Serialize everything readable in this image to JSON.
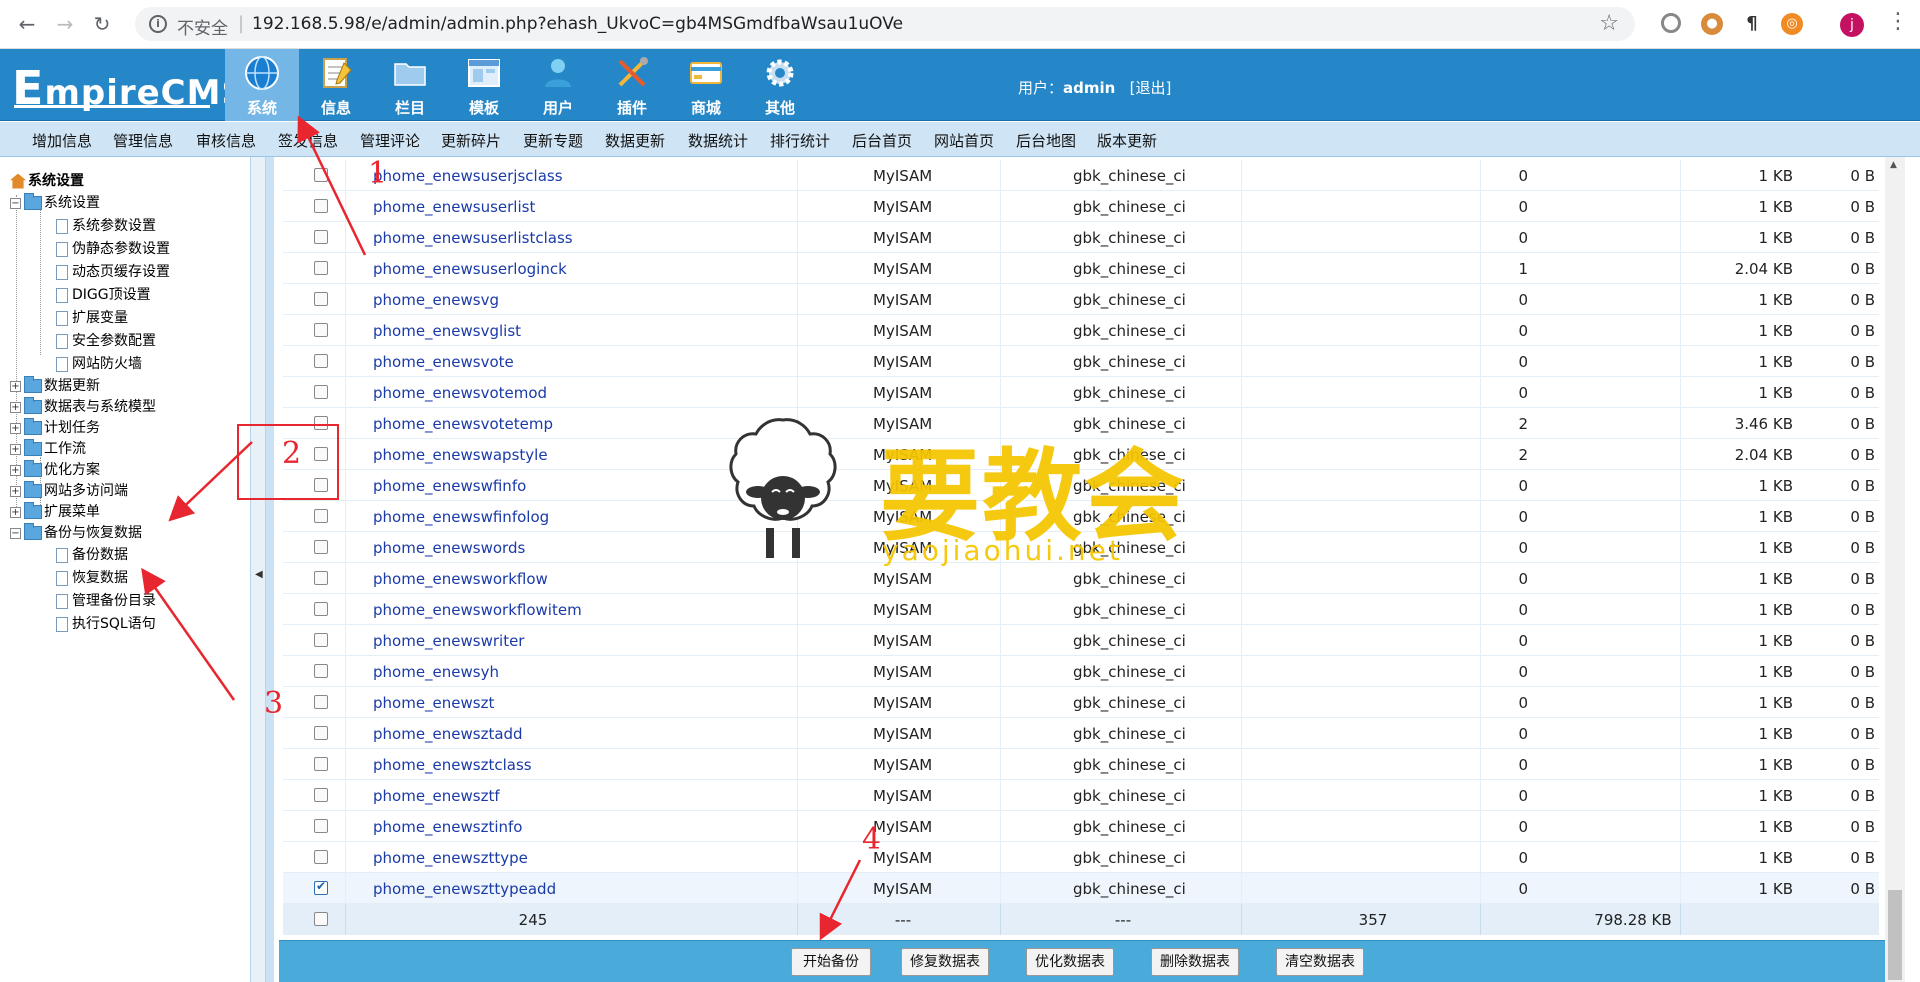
{
  "browser": {
    "security": "不安全",
    "url": "192.168.5.98/e/admin/admin.php?ehash_UkvoC=gb4MSGmdfbaWsau1uOVe",
    "profile_initial": "j"
  },
  "cms": {
    "logo": "EmpireCMS",
    "logo_rest": "mpireCMS",
    "logo_first": "E",
    "top_menu": [
      "系统",
      "信息",
      "栏目",
      "模板",
      "用户",
      "插件",
      "商城",
      "其他"
    ],
    "user_label": "用户：",
    "user_name": "admin",
    "logout": "[退出]",
    "sub_menu": [
      "增加信息",
      "管理信息",
      "审核信息",
      "签发信息",
      "管理评论",
      "更新碎片",
      "更新专题",
      "数据更新",
      "数据统计",
      "排行统计",
      "后台首页",
      "网站首页",
      "后台地图",
      "版本更新"
    ]
  },
  "tree": {
    "root": "系统设置",
    "system": "系统设置",
    "system_children": [
      "系统参数设置",
      "伪静态参数设置",
      "动态页缓存设置",
      "DIGG顶设置",
      "扩展变量",
      "安全参数配置",
      "网站防火墙"
    ],
    "folders": [
      "数据更新",
      "数据表与系统模型",
      "计划任务",
      "工作流",
      "优化方案",
      "网站多访问端",
      "扩展菜单"
    ],
    "backup": "备份与恢复数据",
    "backup_children": [
      "备份数据",
      "恢复数据",
      "管理备份目录",
      "执行SQL语句"
    ]
  },
  "table": {
    "rows": [
      {
        "name": "phome_enewsuserjsclass",
        "engine": "MyISAM",
        "collation": "gbk_chinese_ci",
        "rows": "0",
        "size": "1 KB",
        "free": "0 B",
        "checked": false
      },
      {
        "name": "phome_enewsuserlist",
        "engine": "MyISAM",
        "collation": "gbk_chinese_ci",
        "rows": "0",
        "size": "1 KB",
        "free": "0 B",
        "checked": false
      },
      {
        "name": "phome_enewsuserlistclass",
        "engine": "MyISAM",
        "collation": "gbk_chinese_ci",
        "rows": "0",
        "size": "1 KB",
        "free": "0 B",
        "checked": false
      },
      {
        "name": "phome_enewsuserloginck",
        "engine": "MyISAM",
        "collation": "gbk_chinese_ci",
        "rows": "1",
        "size": "2.04 KB",
        "free": "0 B",
        "checked": false
      },
      {
        "name": "phome_enewsvg",
        "engine": "MyISAM",
        "collation": "gbk_chinese_ci",
        "rows": "0",
        "size": "1 KB",
        "free": "0 B",
        "checked": false
      },
      {
        "name": "phome_enewsvglist",
        "engine": "MyISAM",
        "collation": "gbk_chinese_ci",
        "rows": "0",
        "size": "1 KB",
        "free": "0 B",
        "checked": false
      },
      {
        "name": "phome_enewsvote",
        "engine": "MyISAM",
        "collation": "gbk_chinese_ci",
        "rows": "0",
        "size": "1 KB",
        "free": "0 B",
        "checked": false
      },
      {
        "name": "phome_enewsvotemod",
        "engine": "MyISAM",
        "collation": "gbk_chinese_ci",
        "rows": "0",
        "size": "1 KB",
        "free": "0 B",
        "checked": false
      },
      {
        "name": "phome_enewsvotetemp",
        "engine": "MyISAM",
        "collation": "gbk_chinese_ci",
        "rows": "2",
        "size": "3.46 KB",
        "free": "0 B",
        "checked": false
      },
      {
        "name": "phome_enewswapstyle",
        "engine": "MyISAM",
        "collation": "gbk_chinese_ci",
        "rows": "2",
        "size": "2.04 KB",
        "free": "0 B",
        "checked": false
      },
      {
        "name": "phome_enewswfinfo",
        "engine": "MyISAM",
        "collation": "gbk_chinese_ci",
        "rows": "0",
        "size": "1 KB",
        "free": "0 B",
        "checked": false
      },
      {
        "name": "phome_enewswfinfolog",
        "engine": "MyISAM",
        "collation": "gbk_chinese_ci",
        "rows": "0",
        "size": "1 KB",
        "free": "0 B",
        "checked": false
      },
      {
        "name": "phome_enewswords",
        "engine": "MyISAM",
        "collation": "gbk_chinese_ci",
        "rows": "0",
        "size": "1 KB",
        "free": "0 B",
        "checked": false
      },
      {
        "name": "phome_enewsworkflow",
        "engine": "MyISAM",
        "collation": "gbk_chinese_ci",
        "rows": "0",
        "size": "1 KB",
        "free": "0 B",
        "checked": false
      },
      {
        "name": "phome_enewsworkflowitem",
        "engine": "MyISAM",
        "collation": "gbk_chinese_ci",
        "rows": "0",
        "size": "1 KB",
        "free": "0 B",
        "checked": false
      },
      {
        "name": "phome_enewswriter",
        "engine": "MyISAM",
        "collation": "gbk_chinese_ci",
        "rows": "0",
        "size": "1 KB",
        "free": "0 B",
        "checked": false
      },
      {
        "name": "phome_enewsyh",
        "engine": "MyISAM",
        "collation": "gbk_chinese_ci",
        "rows": "0",
        "size": "1 KB",
        "free": "0 B",
        "checked": false
      },
      {
        "name": "phome_enewszt",
        "engine": "MyISAM",
        "collation": "gbk_chinese_ci",
        "rows": "0",
        "size": "1 KB",
        "free": "0 B",
        "checked": false
      },
      {
        "name": "phome_enewsztadd",
        "engine": "MyISAM",
        "collation": "gbk_chinese_ci",
        "rows": "0",
        "size": "1 KB",
        "free": "0 B",
        "checked": false
      },
      {
        "name": "phome_enewsztclass",
        "engine": "MyISAM",
        "collation": "gbk_chinese_ci",
        "rows": "0",
        "size": "1 KB",
        "free": "0 B",
        "checked": false
      },
      {
        "name": "phome_enewsztf",
        "engine": "MyISAM",
        "collation": "gbk_chinese_ci",
        "rows": "0",
        "size": "1 KB",
        "free": "0 B",
        "checked": false
      },
      {
        "name": "phome_enewsztinfo",
        "engine": "MyISAM",
        "collation": "gbk_chinese_ci",
        "rows": "0",
        "size": "1 KB",
        "free": "0 B",
        "checked": false
      },
      {
        "name": "phome_enewszttype",
        "engine": "MyISAM",
        "collation": "gbk_chinese_ci",
        "rows": "0",
        "size": "1 KB",
        "free": "0 B",
        "checked": false
      },
      {
        "name": "phome_enewszttypeadd",
        "engine": "MyISAM",
        "collation": "gbk_chinese_ci",
        "rows": "0",
        "size": "1 KB",
        "free": "0 B",
        "checked": true
      }
    ],
    "total": {
      "tables": "245",
      "engine": "---",
      "collation": "---",
      "rows": "357",
      "size": "798.28 KB"
    }
  },
  "buttons": [
    "开始备份",
    "修复数据表",
    "优化数据表",
    "删除数据表",
    "清空数据表"
  ],
  "annotations": [
    "1",
    "2",
    "3",
    "4"
  ],
  "watermark": {
    "text": "要教会",
    "sub": "yaojiaohui.net"
  },
  "colors": {
    "header": "#2687c8",
    "submenu": "#cfe5f6",
    "link": "#1a3aa8",
    "annotation": "#e8262f",
    "watermark": "#f6c500",
    "bottom_bar": "#4aaad9"
  }
}
